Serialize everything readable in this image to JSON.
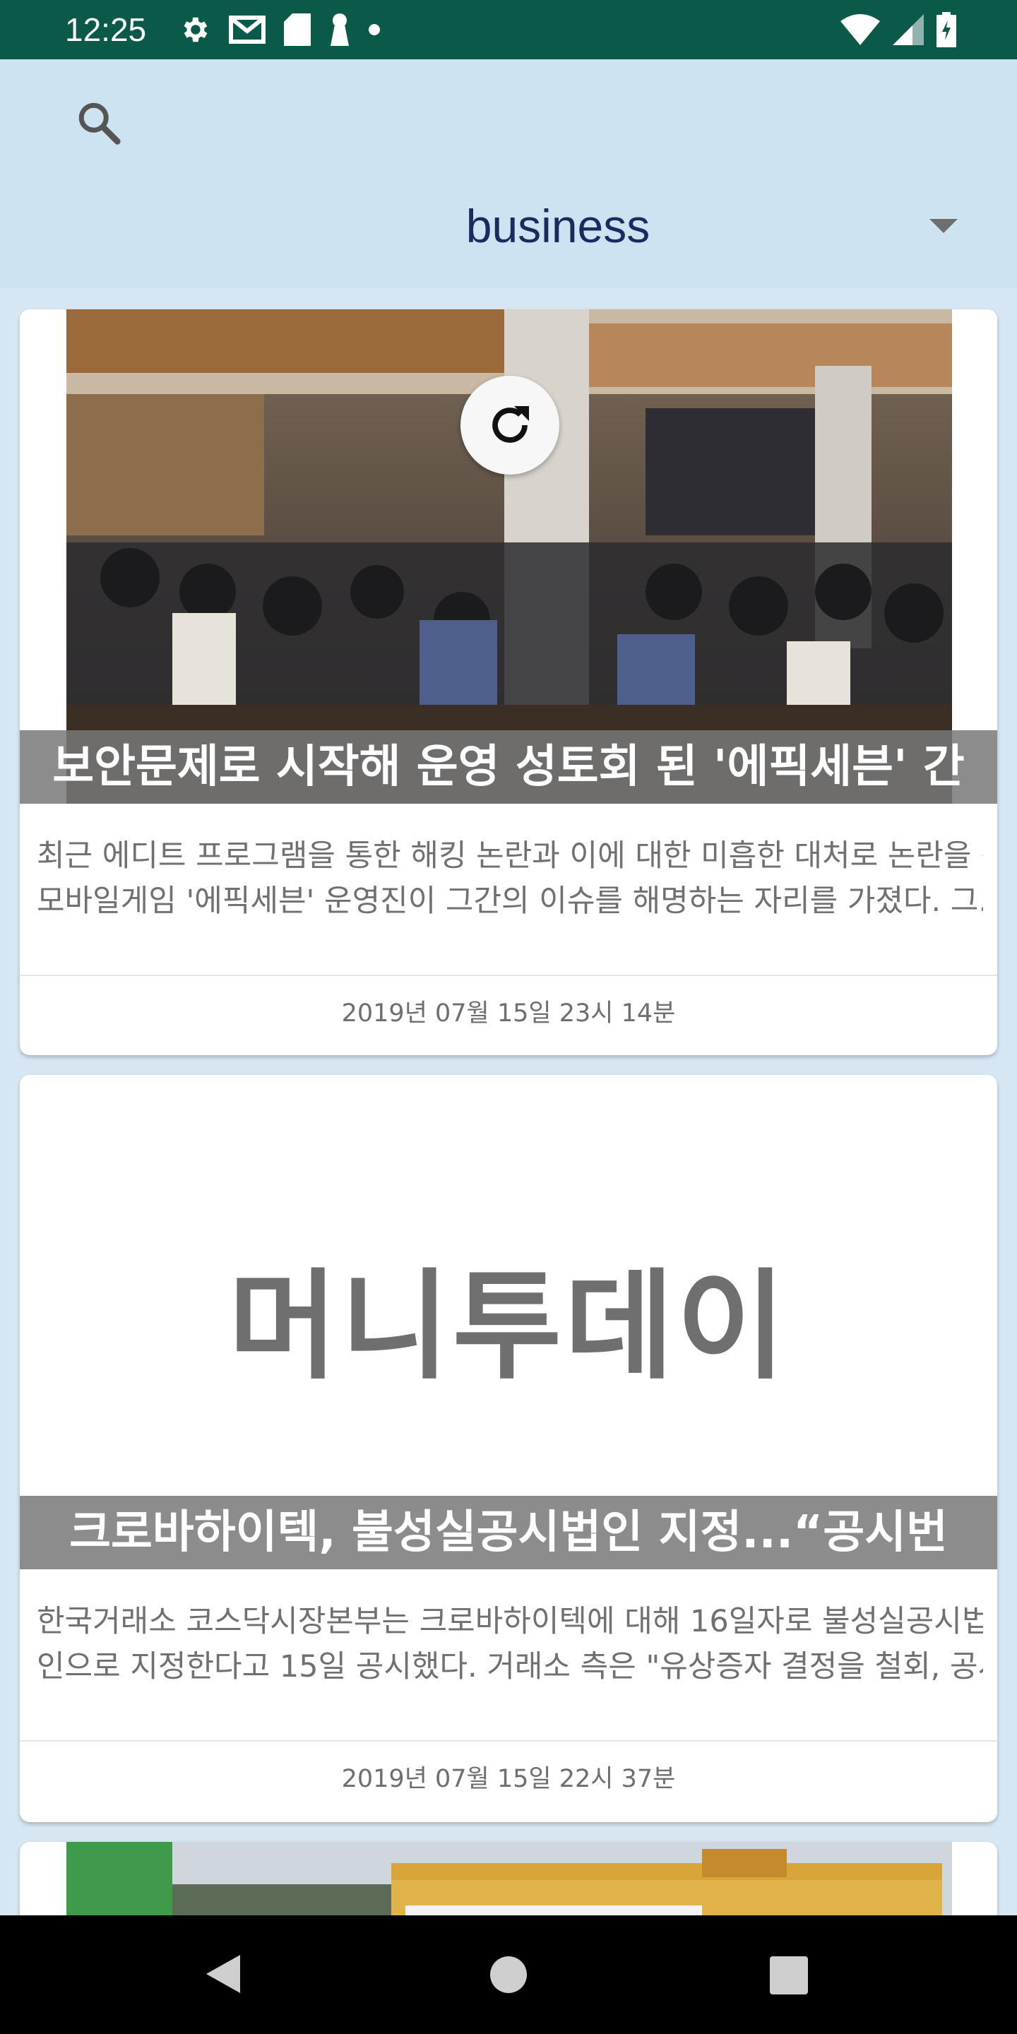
{
  "status_bar": {
    "time": "12:25",
    "left_icons": [
      "gear-icon",
      "gmail-icon",
      "sd-card-icon",
      "keyhole-icon",
      "dot-icon"
    ],
    "right_icons": [
      "wifi-icon",
      "signal-icon",
      "battery-charging-icon"
    ]
  },
  "header": {
    "search_icon": "search-icon",
    "category": "business",
    "dropdown_icon": "arrow-drop-down-icon"
  },
  "articles": [
    {
      "title": "보안문제로 시작해 운영 성토회 된 '에픽세븐' 간",
      "description_lines": [
        "최근 에디트 프로그램을 통한 해킹 논란과 이에 대한 미흡한 대처로 논란을 산",
        "모바일게임 '에픽세븐' 운영진이 그간의 이슈를 해명하는 자리를 가졌다. 그..."
      ],
      "date": "2019년 07월 15일 23시 14분"
    },
    {
      "logo_text": "머니투데이",
      "title": "크로바하이텍, 불성실공시법인 지정...“공시번",
      "description_lines": [
        "한국거래소 코스닥시장본부는 크로바하이텍에 대해 16일자로 불성실공시법",
        "인으로 지정한다고 15일 공시했다. 거래소 측은 \"유상증자 결정을 철회, 공시..."
      ],
      "date": "2019년 07월 15일 22시 37분"
    }
  ],
  "colors": {
    "status_bar": "#0b5a49",
    "header_bg": "#cde3f2",
    "list_bg": "#d6e6f3",
    "category_text": "#1b2b5e"
  }
}
